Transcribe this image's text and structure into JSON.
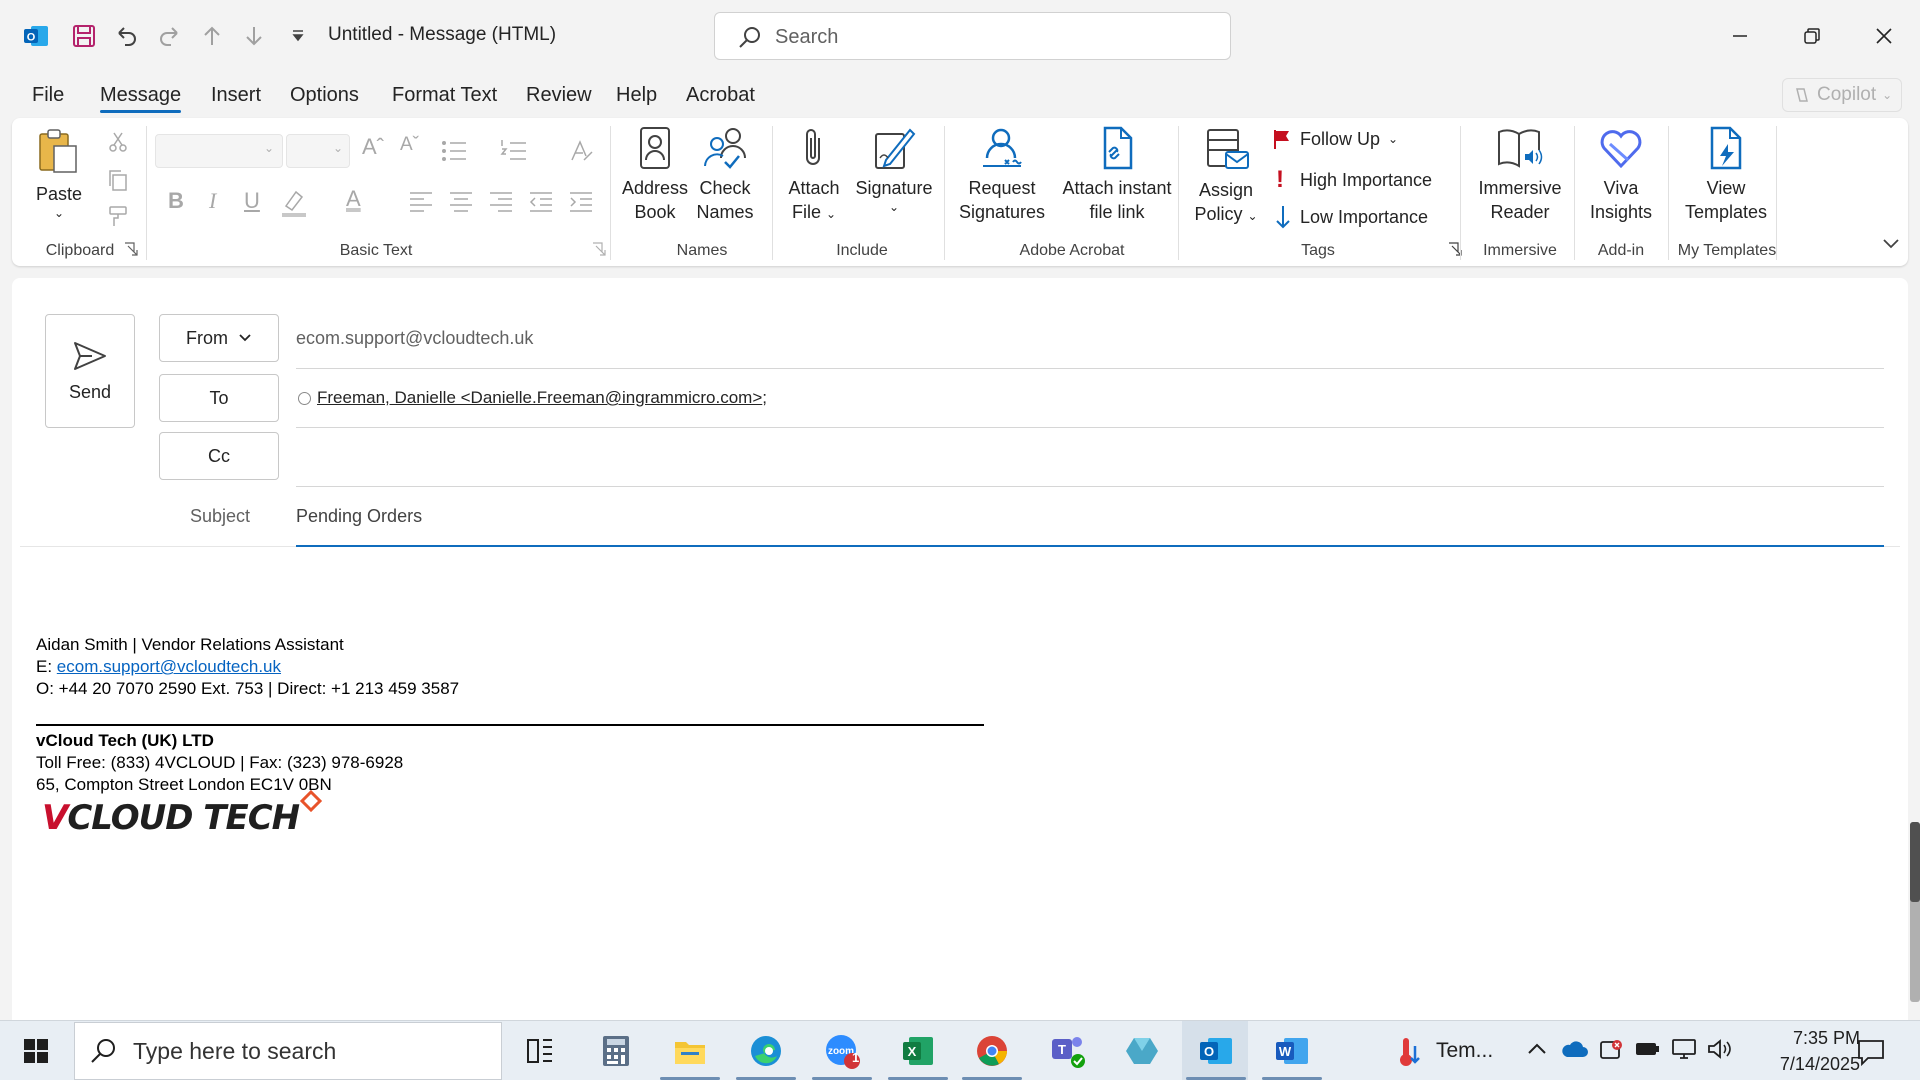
{
  "titlebar": {
    "title": "Untitled  -  Message (HTML)",
    "search_placeholder": "Search"
  },
  "menu": {
    "tabs": [
      "File",
      "Message",
      "Insert",
      "Options",
      "Format Text",
      "Review",
      "Help",
      "Acrobat"
    ],
    "active": "Message",
    "copilot_label": "Copilot"
  },
  "ribbon": {
    "groups": {
      "clipboard": "Clipboard",
      "basic_text": "Basic Text",
      "names": "Names",
      "include": "Include",
      "adobe_acrobat": "Adobe Acrobat",
      "tags": "Tags",
      "immersive": "Immersive",
      "add_in": "Add-in",
      "my_templates": "My Templates"
    },
    "buttons": {
      "paste": "Paste",
      "address_book_1": "Address",
      "address_book_2": "Book",
      "check_names_1": "Check",
      "check_names_2": "Names",
      "attach_file_1": "Attach",
      "attach_file_2": "File",
      "signature": "Signature",
      "request_signatures_1": "Request",
      "request_signatures_2": "Signatures",
      "attach_link_1": "Attach instant",
      "attach_link_2": "file link",
      "assign_policy_1": "Assign",
      "assign_policy_2": "Policy",
      "follow_up": "Follow Up",
      "high_importance": "High Importance",
      "low_importance": "Low Importance",
      "immersive_reader_1": "Immersive",
      "immersive_reader_2": "Reader",
      "viva_insights_1": "Viva",
      "viva_insights_2": "Insights",
      "view_templates_1": "View",
      "view_templates_2": "Templates"
    }
  },
  "compose": {
    "send_label": "Send",
    "from_label": "From",
    "from_value": "ecom.support@vcloudtech.uk",
    "to_label": "To",
    "to_value": "Freeman, Danielle <Danielle.Freeman@ingrammicro.com>",
    "to_sep": ";",
    "cc_label": "Cc",
    "subject_label": "Subject",
    "subject_value": "Pending Orders"
  },
  "signature": {
    "name_line": "Aidan Smith | Vendor Relations Assistant",
    "email_prefix": "E: ",
    "email": "ecom.support@vcloudtech.uk",
    "office_line": "O:  +44 20 7070 2590 Ext. 753 | Direct: +1 213 459 3587",
    "company": "vCloud Tech (UK) LTD",
    "tollfree_line": "Toll Free: (833) 4VCLOUD | Fax: (323) 978-6928",
    "address_line": "65, Compton Street London EC1V 0BN",
    "logo_v": "V",
    "logo_rest": "CLOUD TECH"
  },
  "taskbar": {
    "search_placeholder": "Type here to search",
    "weather_label": "Tem...",
    "time": "7:35 PM",
    "date": "7/14/2025",
    "zoom_badge": "1"
  },
  "colors": {
    "accent": "#0f6cbd",
    "link": "#0563c1",
    "high_importance": "#c50f1f"
  }
}
